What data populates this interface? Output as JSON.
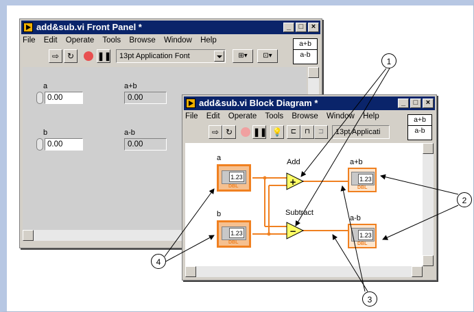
{
  "front_panel": {
    "title": "add&sub.vi Front Panel *",
    "menu": [
      "File",
      "Edit",
      "Operate",
      "Tools",
      "Browse",
      "Window",
      "Help"
    ],
    "font": "13pt Application Font",
    "help": [
      "a+b",
      "a-b"
    ],
    "controls": [
      {
        "label": "a",
        "value": "0.00"
      },
      {
        "label": "b",
        "value": "0.00"
      }
    ],
    "indicators": [
      {
        "label": "a+b",
        "value": "0.00"
      },
      {
        "label": "a-b",
        "value": "0.00"
      }
    ]
  },
  "block_diagram": {
    "title": "add&sub.vi Block Diagram *",
    "menu": [
      "File",
      "Edit",
      "Operate",
      "Tools",
      "Browse",
      "Window",
      "Help"
    ],
    "font": "13pt Applicati",
    "help": [
      "a+b",
      "a-b"
    ],
    "terminals": [
      {
        "label": "a",
        "value": "1.23",
        "type": "DBL"
      },
      {
        "label": "b",
        "value": "1.23",
        "type": "DBL"
      }
    ],
    "indicators": [
      {
        "label": "a+b",
        "value": "1.23",
        "type": "DBL"
      },
      {
        "label": "a-b",
        "value": "1.23",
        "type": "DBL"
      }
    ],
    "functions": [
      {
        "label": "Add",
        "symbol": "+"
      },
      {
        "label": "Subtract",
        "symbol": "−"
      }
    ]
  },
  "callouts": [
    "1",
    "2",
    "3",
    "4"
  ],
  "colors": {
    "titlebar": "#0a246a",
    "terminal": "#f08020",
    "wire": "#f08020"
  }
}
